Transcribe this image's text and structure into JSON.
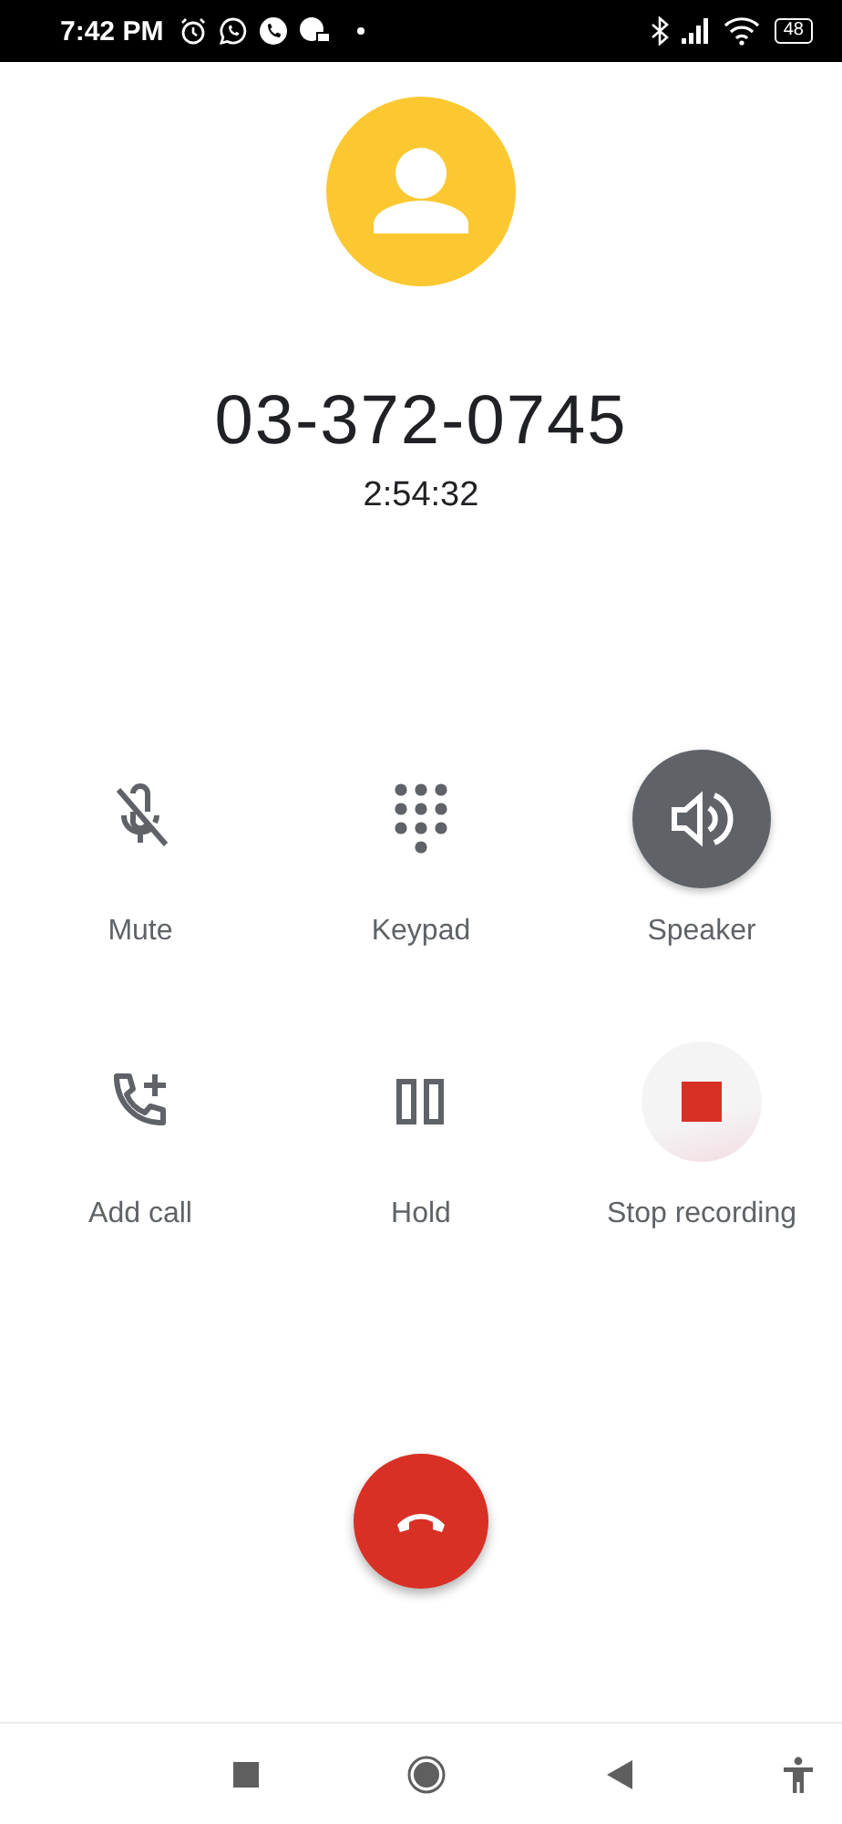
{
  "status_bar": {
    "time": "7:42 PM",
    "battery": "48"
  },
  "caller": {
    "number": "03-372-0745",
    "duration": "2:54:32"
  },
  "controls": [
    {
      "kind": "mute",
      "label": "Mute",
      "selected": false
    },
    {
      "kind": "keypad",
      "label": "Keypad",
      "selected": false
    },
    {
      "kind": "speaker",
      "label": "Speaker",
      "selected": true
    },
    {
      "kind": "addcall",
      "label": "Add call",
      "selected": false
    },
    {
      "kind": "hold",
      "label": "Hold",
      "selected": false
    },
    {
      "kind": "record",
      "label": "Stop recording",
      "selected": true
    }
  ]
}
